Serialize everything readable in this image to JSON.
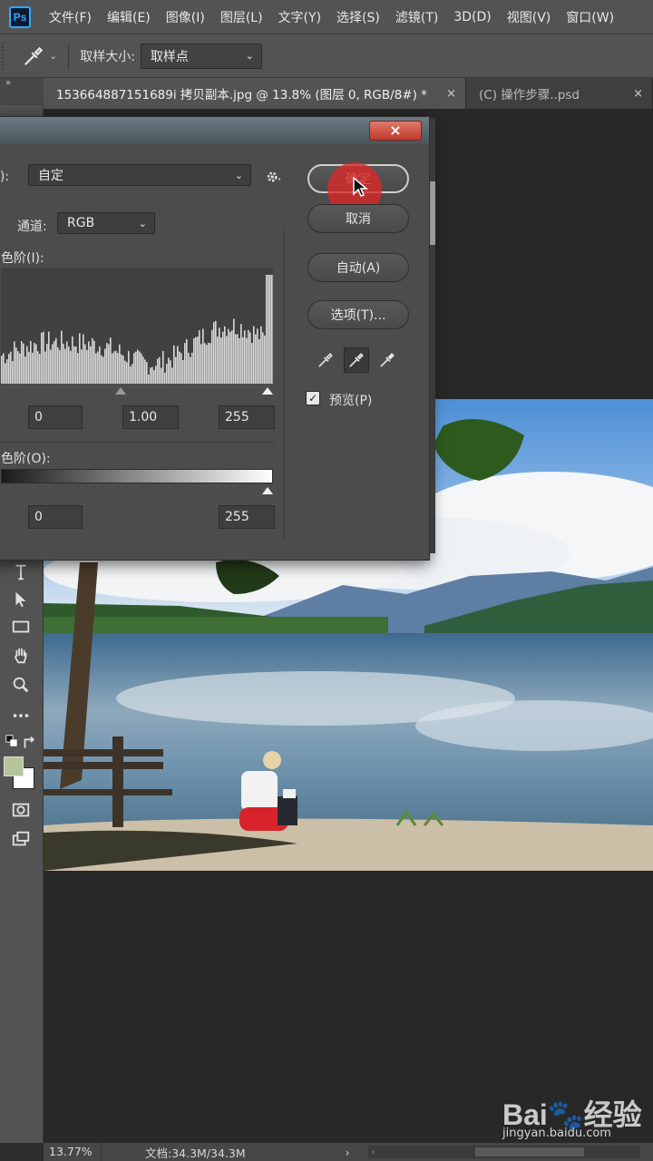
{
  "app": {
    "logo": "Ps",
    "menu": [
      "文件(F)",
      "编辑(E)",
      "图像(I)",
      "图层(L)",
      "文字(Y)",
      "选择(S)",
      "滤镜(T)",
      "3D(D)",
      "视图(V)",
      "窗口(W)"
    ]
  },
  "options_bar": {
    "tool_icon": "eyedropper-icon",
    "sample_size_label": "取样大小:",
    "sample_size_value": "取样点"
  },
  "tabs": [
    {
      "label": "153664887151689i 拷贝副本.jpg @ 13.8% (图层 0, RGB/8#) *",
      "close": "×",
      "active": true
    },
    {
      "label": "(C) 操作步骤..psd",
      "close": "×",
      "active": false
    }
  ],
  "toolbar": {
    "collapse": "»",
    "tools": [
      "type-icon",
      "path-select-icon",
      "rectangle-icon",
      "hand-icon",
      "zoom-icon",
      "more-icon",
      "swap-colors-icon",
      "color-swatches",
      "quick-mask-icon",
      "screen-mode-icon"
    ],
    "foreground_color": "#b7c39a",
    "background_color": "#ffffff"
  },
  "levels_dialog": {
    "close": "×",
    "preset_label": "E):",
    "preset_value": "自定",
    "channel_label": "通道:",
    "channel_value": "RGB",
    "input_levels_label": "色阶(I):",
    "input_values": [
      "0",
      "1.00",
      "255"
    ],
    "output_levels_label": "色阶(O):",
    "output_values": [
      "0",
      "255"
    ],
    "buttons": {
      "ok": "确定",
      "cancel": "取消",
      "auto": "自动(A)",
      "options": "选项(T)..."
    },
    "eyedroppers": [
      "black-eyedropper-icon",
      "gray-eyedropper-icon",
      "white-eyedropper-icon"
    ],
    "preview_label": "预览(P)",
    "preview_checked": true
  },
  "status_bar": {
    "zoom": "13.77%",
    "doc_size": "文档:34.3M/34.3M",
    "arrow": "›",
    "scroll_left": "‹"
  },
  "watermark": {
    "logo": "Bai🐾经验",
    "url": "jingyan.baidu.com"
  }
}
